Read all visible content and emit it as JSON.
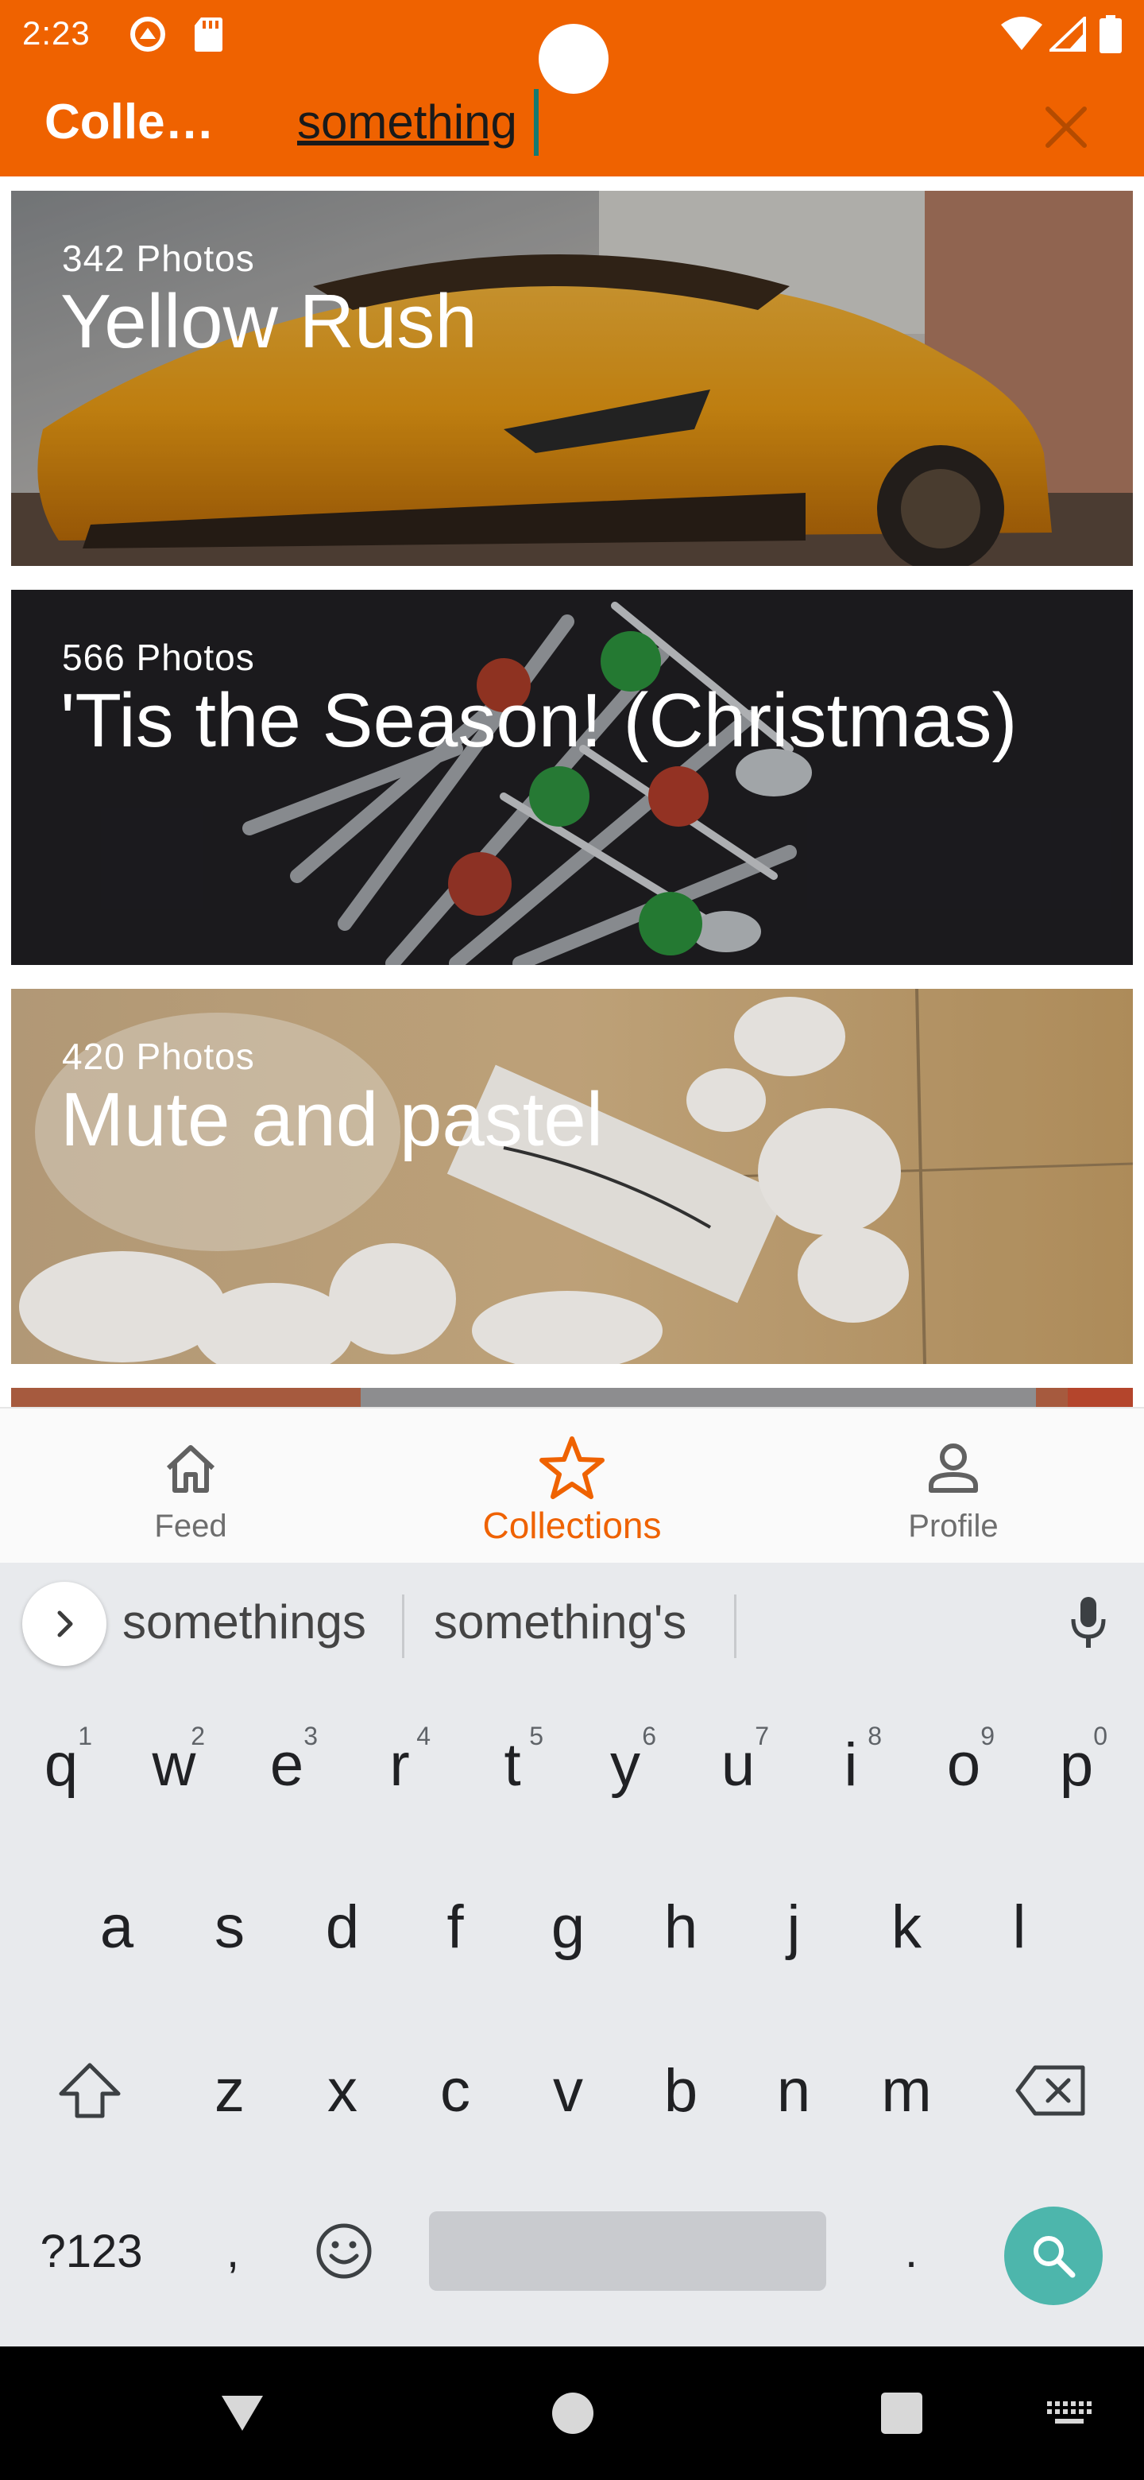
{
  "status_bar": {
    "time": "2:23",
    "icons": [
      "vpn-circle-icon",
      "sd-card-icon",
      "wifi-icon",
      "signal-icon",
      "battery-icon"
    ]
  },
  "app_bar": {
    "title": "Colle…",
    "search": {
      "value": "something",
      "placeholder": ""
    },
    "clear_icon": "close-icon",
    "accent": "#ef6200"
  },
  "collections": [
    {
      "count": "342",
      "count_label": "Photos",
      "title": "Yellow Rush"
    },
    {
      "count": "566",
      "count_label": "Photos",
      "title": "'Tis the Season! (Christmas)"
    },
    {
      "count": "420",
      "count_label": "Photos",
      "title": "Mute and pastel"
    }
  ],
  "bottom_nav": {
    "items": [
      {
        "label": "Feed",
        "icon": "home-icon",
        "active": false
      },
      {
        "label": "Collections",
        "icon": "star-icon",
        "active": true
      },
      {
        "label": "Profile",
        "icon": "person-icon",
        "active": false
      }
    ]
  },
  "keyboard": {
    "suggestions": [
      "somethings",
      "something's"
    ],
    "row1": [
      {
        "key": "q",
        "hint": "1"
      },
      {
        "key": "w",
        "hint": "2"
      },
      {
        "key": "e",
        "hint": "3"
      },
      {
        "key": "r",
        "hint": "4"
      },
      {
        "key": "t",
        "hint": "5"
      },
      {
        "key": "y",
        "hint": "6"
      },
      {
        "key": "u",
        "hint": "7"
      },
      {
        "key": "i",
        "hint": "8"
      },
      {
        "key": "o",
        "hint": "9"
      },
      {
        "key": "p",
        "hint": "0"
      }
    ],
    "row2": [
      "a",
      "s",
      "d",
      "f",
      "g",
      "h",
      "j",
      "k",
      "l"
    ],
    "row3": [
      "z",
      "x",
      "c",
      "v",
      "b",
      "n",
      "m"
    ],
    "symbols_key": "?123",
    "comma_key": ",",
    "period_key": ".",
    "search_color": "#4db6ac"
  }
}
